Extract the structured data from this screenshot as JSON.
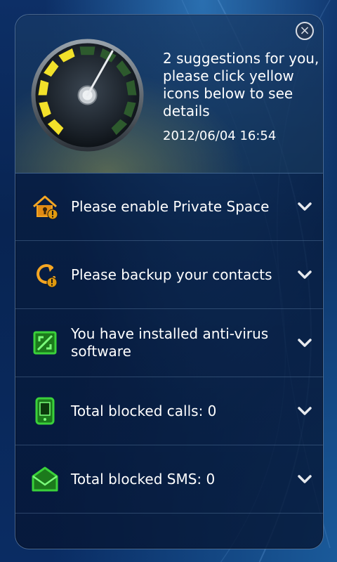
{
  "header": {
    "suggestion_text": "2 suggestions for you, please click yellow icons below to see details",
    "timestamp": "2012/06/04 16:54",
    "close_icon": "close-icon",
    "gauge_icon": "speedometer-gauge-icon"
  },
  "items": [
    {
      "label": "Please enable Private Space",
      "icon": "house-lock-warning-icon",
      "status": "warning",
      "color": "#f5a623"
    },
    {
      "label": "Please backup your contacts",
      "icon": "sync-warning-icon",
      "status": "warning",
      "color": "#f5a623"
    },
    {
      "label": "You have installed anti-virus software",
      "icon": "shield-frame-icon",
      "status": "ok",
      "color": "#3ad13a"
    },
    {
      "label": "Total blocked calls: 0",
      "icon": "phone-icon",
      "status": "ok",
      "color": "#3ad13a"
    },
    {
      "label": "Total blocked SMS: 0",
      "icon": "envelope-icon",
      "status": "ok",
      "color": "#3ad13a"
    }
  ]
}
